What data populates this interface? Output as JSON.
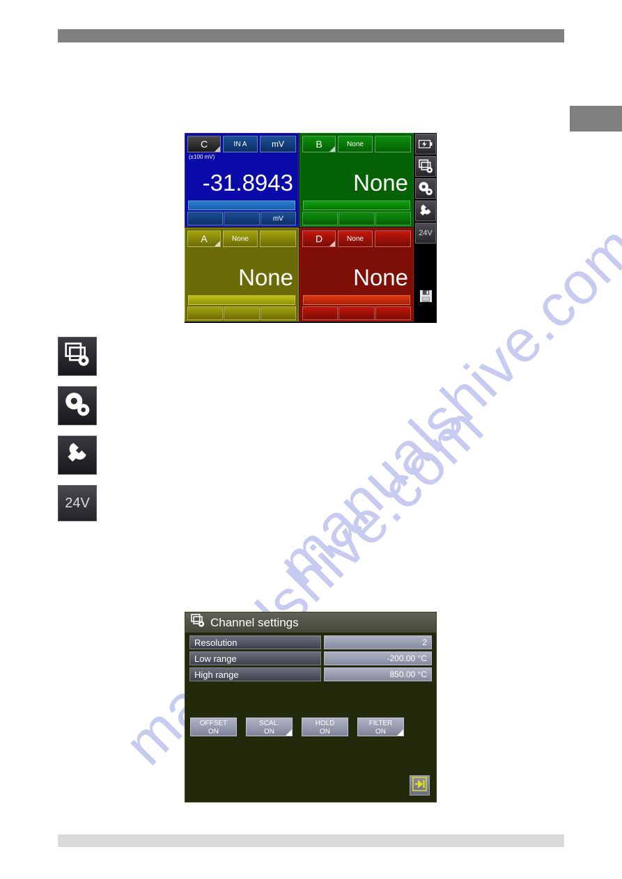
{
  "watermark": {
    "line1": "manualshive.com",
    "line2": "manualshive.com"
  },
  "device_screen": {
    "channels": [
      {
        "id": "channel-c",
        "letter": "C",
        "input_label": "IN A",
        "unit_label": "mV",
        "range_note": "(±100 mV)",
        "value": "-31.8943",
        "footer": [
          "",
          "",
          "mV"
        ],
        "color": "#0a0aa8"
      },
      {
        "id": "channel-b",
        "letter": "B",
        "input_label": "None",
        "unit_label": "",
        "range_note": "",
        "value": "None",
        "footer": [
          "",
          "",
          ""
        ],
        "color": "#056105"
      },
      {
        "id": "channel-a",
        "letter": "A",
        "input_label": "None",
        "unit_label": "",
        "range_note": "",
        "value": "None",
        "footer": [
          "",
          "",
          ""
        ],
        "color": "#6a6a06"
      },
      {
        "id": "channel-d",
        "letter": "D",
        "input_label": "None",
        "unit_label": "",
        "range_note": "",
        "value": "None",
        "footer": [
          "",
          "",
          ""
        ],
        "color": "#7d0f06"
      }
    ],
    "rail": [
      {
        "icon": "battery-charging-icon",
        "label": ""
      },
      {
        "icon": "channel-settings-icon",
        "label": ""
      },
      {
        "icon": "device-settings-icon",
        "label": ""
      },
      {
        "icon": "service-wrench-icon",
        "label": ""
      },
      {
        "icon": "24v-supply-icon",
        "label": "24V"
      },
      {
        "icon": "save-floppy-icon",
        "label": ""
      }
    ]
  },
  "left_icons": [
    {
      "icon": "channel-settings-icon",
      "label": ""
    },
    {
      "icon": "device-settings-icon",
      "label": ""
    },
    {
      "icon": "service-wrench-icon",
      "label": ""
    },
    {
      "icon": "24v-supply-icon",
      "label": "24V"
    }
  ],
  "dialog": {
    "title": "Channel settings",
    "title_icon": "channel-settings-icon",
    "rows": [
      {
        "label": "Resolution",
        "value": "2"
      },
      {
        "label": "Low range",
        "value": "-200.00 °C"
      },
      {
        "label": "High range",
        "value": "850.00 °C"
      }
    ],
    "buttons": [
      {
        "line1": "OFFSET",
        "line2": "ON",
        "marked": false
      },
      {
        "line1": "SCAL.",
        "line2": "ON",
        "marked": true
      },
      {
        "line1": "HOLD",
        "line2": "ON",
        "marked": false
      },
      {
        "line1": "FILTER",
        "line2": "ON",
        "marked": true
      }
    ],
    "exit_icon": "exit-arrow-icon"
  }
}
